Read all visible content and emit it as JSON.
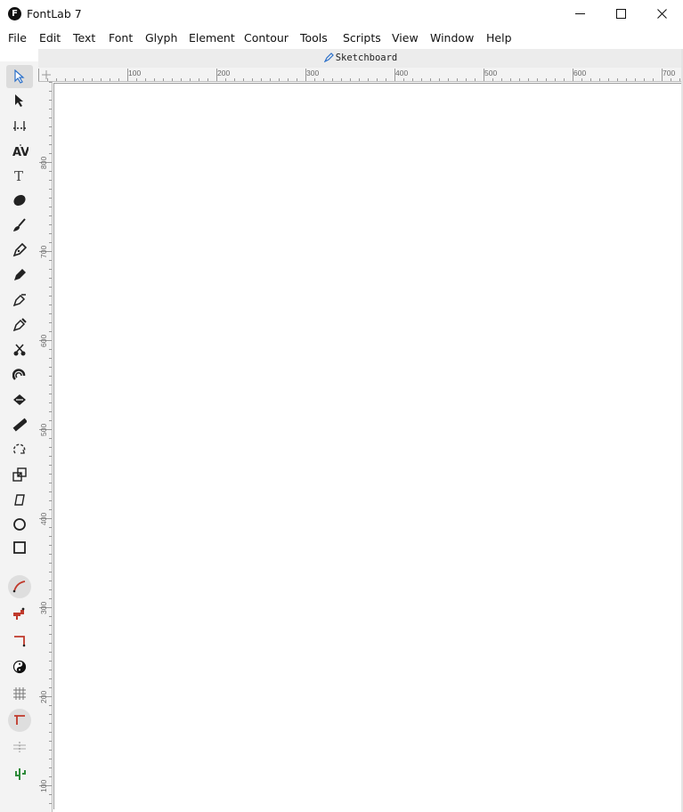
{
  "window": {
    "title": "FontLab 7",
    "logo_letter": "F"
  },
  "menu": [
    "File",
    "Edit",
    "Text",
    "Font",
    "Glyph",
    "Element",
    "Contour",
    "Tools",
    "Scripts",
    "View",
    "Window",
    "Help"
  ],
  "tab": {
    "label": "Sketchboard"
  },
  "rulers": {
    "horizontal": [
      "100",
      "200",
      "300",
      "400",
      "500",
      "600",
      "700"
    ],
    "vertical": [
      "800",
      "700",
      "600",
      "500",
      "400",
      "300",
      "200",
      "100"
    ]
  },
  "tools": [
    "contour-tool-icon",
    "element-tool-icon",
    "metrics-tool-icon",
    "kerning-tool-icon",
    "text-tool-icon",
    "eraser-tool-icon",
    "brush-tool-icon",
    "pencil-tool-icon",
    "pen-tool-icon",
    "rapid-tool-icon",
    "power-nib-icon",
    "knife-tool-icon",
    "magnet-tool-icon",
    "fill-tool-icon",
    "ruler-tool-icon",
    "rotate-tool-icon",
    "scale-tool-icon",
    "slant-tool-icon",
    "ellipse-tool-icon",
    "rectangle-tool-icon",
    "smooth-curve-icon",
    "hammer-tool-icon",
    "corner-tool-icon",
    "yin-yang-icon",
    "grid-icon",
    "tee-tool-icon",
    "guides-icon",
    "cactus-icon"
  ],
  "colors": {
    "accent_blue": "#2a6fc9",
    "toolbar_bg": "#f3f3f3",
    "red_tool": "#c0392b",
    "green_tool": "#2e8b3a"
  }
}
